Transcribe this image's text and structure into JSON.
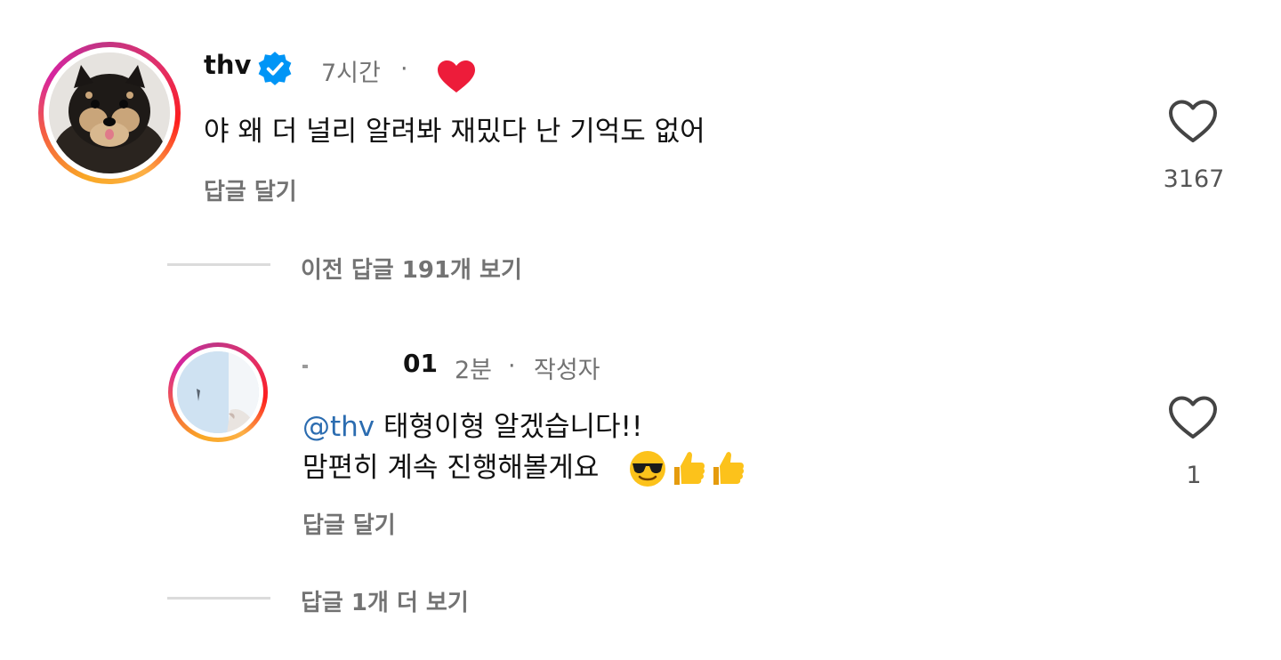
{
  "comment1": {
    "username": "thv",
    "time": "7시간",
    "dot": "·",
    "text": "야 왜 더 널리 알려봐 재밌다 난 기억도 없어",
    "reply_label": "답글 달기",
    "like_count": "3167",
    "liked_by_author_icon": "heart-icon",
    "avatar_icon": "dog-avatar"
  },
  "view_previous": {
    "label": "이전 답글 191개 보기"
  },
  "comment2": {
    "username_visible": "01",
    "time": "2분",
    "dot": "·",
    "author_badge": "작성자",
    "mention": "@thv",
    "text_line1": "태형이형 알겠습니다!!",
    "text_line2": "맘편히 계속 진행해볼게요",
    "emojis": [
      "sunglasses-face",
      "thumbs-up",
      "thumbs-up"
    ],
    "reply_label": "답글 달기",
    "like_count": "1"
  },
  "view_more": {
    "label": "답글 1개 더 보기"
  },
  "colors": {
    "verified_blue": "#0095f6",
    "heart_red": "#ed1c3a",
    "mention_blue": "#2b6cb0",
    "muted_text": "#737373"
  }
}
